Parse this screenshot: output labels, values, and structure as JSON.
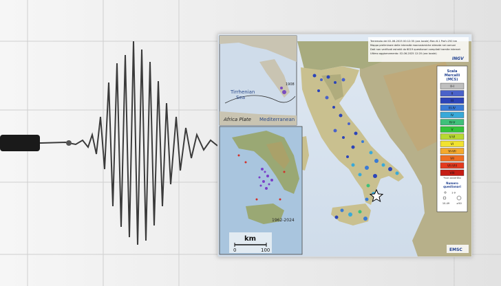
{
  "header": {
    "lines": [
      "Terremoto del 02-06-2025 00:12:35 (ora locale) Mw=6.1 Prof=250 km",
      "Mappa preliminare delle intensità macrosismiche stimate nei comuni",
      "Dati non verificati estratti da 6019 questionari compilati tramite internet",
      "Ultimo aggiornamento: 02-06-2025 12:20 (ora locale)"
    ],
    "agency": "INGV"
  },
  "inset_top": {
    "sea1": "Tirrhenian",
    "sea1b": "Sea",
    "sea2": "Mediterranean",
    "plate": "Africa Plate",
    "year": "1908"
  },
  "inset_bottom": {
    "period": "1962-2024"
  },
  "scale_bar": {
    "unit": "km",
    "zero": "0",
    "max": "100"
  },
  "legend": {
    "title1": "Scala",
    "title2": "Mercalli",
    "title3": "(MCS)",
    "classes": [
      {
        "label": "II-I",
        "color": "#bfbfbf"
      },
      {
        "label": "II",
        "color": "#4a62c9"
      },
      {
        "label": "III",
        "color": "#2c44b8"
      },
      {
        "label": "III-IV",
        "color": "#3a7bd5"
      },
      {
        "label": "IV",
        "color": "#39a9d8"
      },
      {
        "label": "IV-V",
        "color": "#3fc07a"
      },
      {
        "label": "V",
        "color": "#34c43a"
      },
      {
        "label": "V-VI",
        "color": "#b8d832"
      },
      {
        "label": "VI",
        "color": "#f1e230"
      },
      {
        "label": "VI-VII",
        "color": "#f4a92c"
      },
      {
        "label": "VII",
        "color": "#ef6f22"
      },
      {
        "label": "VII-VIII",
        "color": "#e33a1e"
      },
      {
        "label": "VIII",
        "color": "#c51c14"
      }
    ],
    "not_felt": "*non avvertito",
    "count_title1": "Numero",
    "count_title2": "questionari",
    "count_small": "1-9",
    "count_mid": "10-49",
    "count_large": "≥50"
  },
  "footer": {
    "credit": "EMSC"
  }
}
